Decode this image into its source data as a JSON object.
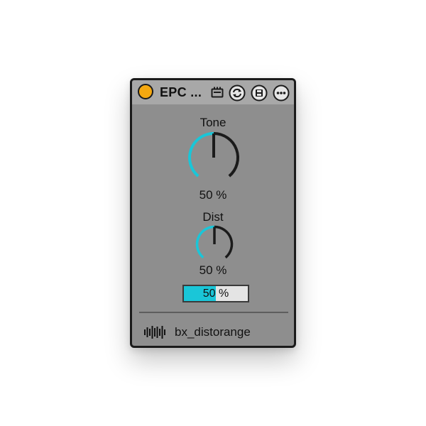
{
  "device": {
    "name": "EPC ...",
    "power_color": "#f5a80f",
    "icons": [
      "midi-map-icon",
      "refresh-icon",
      "save-icon",
      "more-icon"
    ]
  },
  "controls": {
    "tone": {
      "label": "Tone",
      "value_text": "50 %",
      "value": 0.5
    },
    "dist": {
      "label": "Dist",
      "value_text": "50 %",
      "value": 0.5
    },
    "mix": {
      "value_text": "50 %",
      "value": 0.5
    }
  },
  "footer": {
    "label": "bx_distorange"
  },
  "colors": {
    "accent": "#1ac6d8",
    "panel": "#8e8e8e",
    "title_bar": "#a8a8a8",
    "border": "#1b1b1b"
  }
}
